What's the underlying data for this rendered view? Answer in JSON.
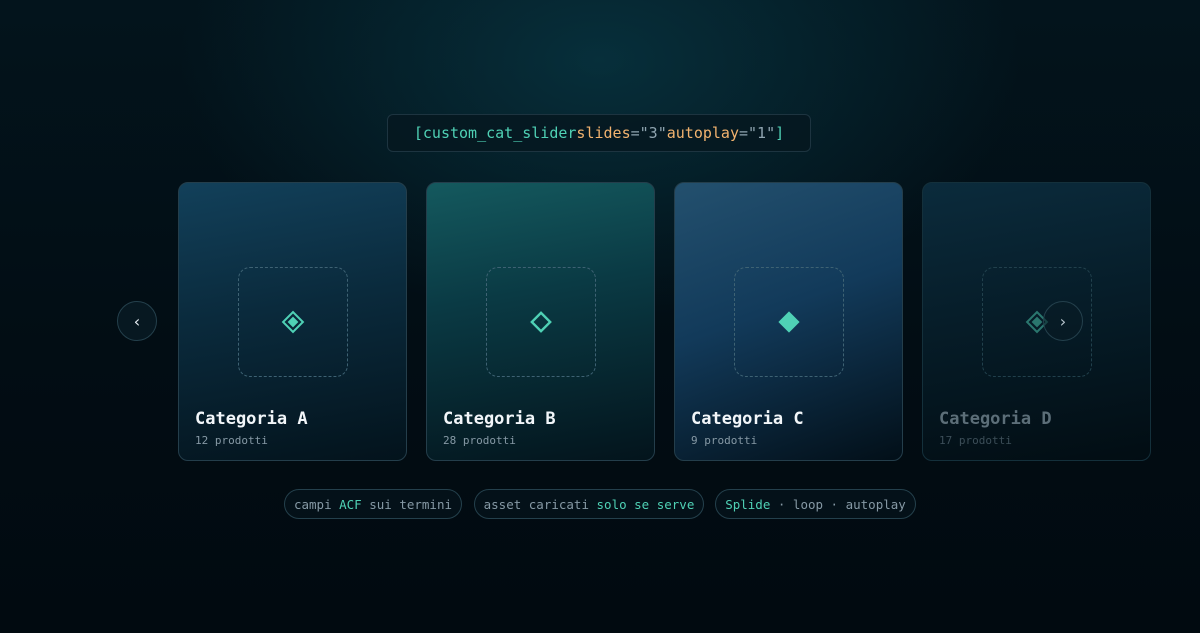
{
  "shortcode": {
    "open": "[",
    "tag": "custom_cat_slider",
    "attr1_name": "slides",
    "attr1_eq": "=",
    "attr1_value": "\"3\"",
    "attr2_name": "autoplay",
    "attr2_eq": "=",
    "attr2_value": "\"1\"",
    "close": "]"
  },
  "nav": {
    "prev_icon": "‹",
    "next_icon": "›"
  },
  "cards": [
    {
      "title": "Categoria A",
      "count": "12 prodotti",
      "icon": "diamond-layered-icon"
    },
    {
      "title": "Categoria B",
      "count": "28 prodotti",
      "icon": "diamond-outline-icon"
    },
    {
      "title": "Categoria C",
      "count": "9 prodotti",
      "icon": "diamond-solid-icon"
    },
    {
      "title": "Categoria D",
      "count": "17 prodotti",
      "icon": "diamond-layered-icon"
    }
  ],
  "pills": [
    {
      "pre": "campi ",
      "highlight": "ACF",
      "post": " sui termini"
    },
    {
      "pre": "asset caricati ",
      "highlight": "solo se serve",
      "post": ""
    },
    {
      "pre": "",
      "highlight": "Splide",
      "post": " · loop · autoplay"
    }
  ],
  "colors": {
    "accent": "#4fd1b5",
    "attr_orange": "#f2b36f",
    "background": "#020d14"
  }
}
